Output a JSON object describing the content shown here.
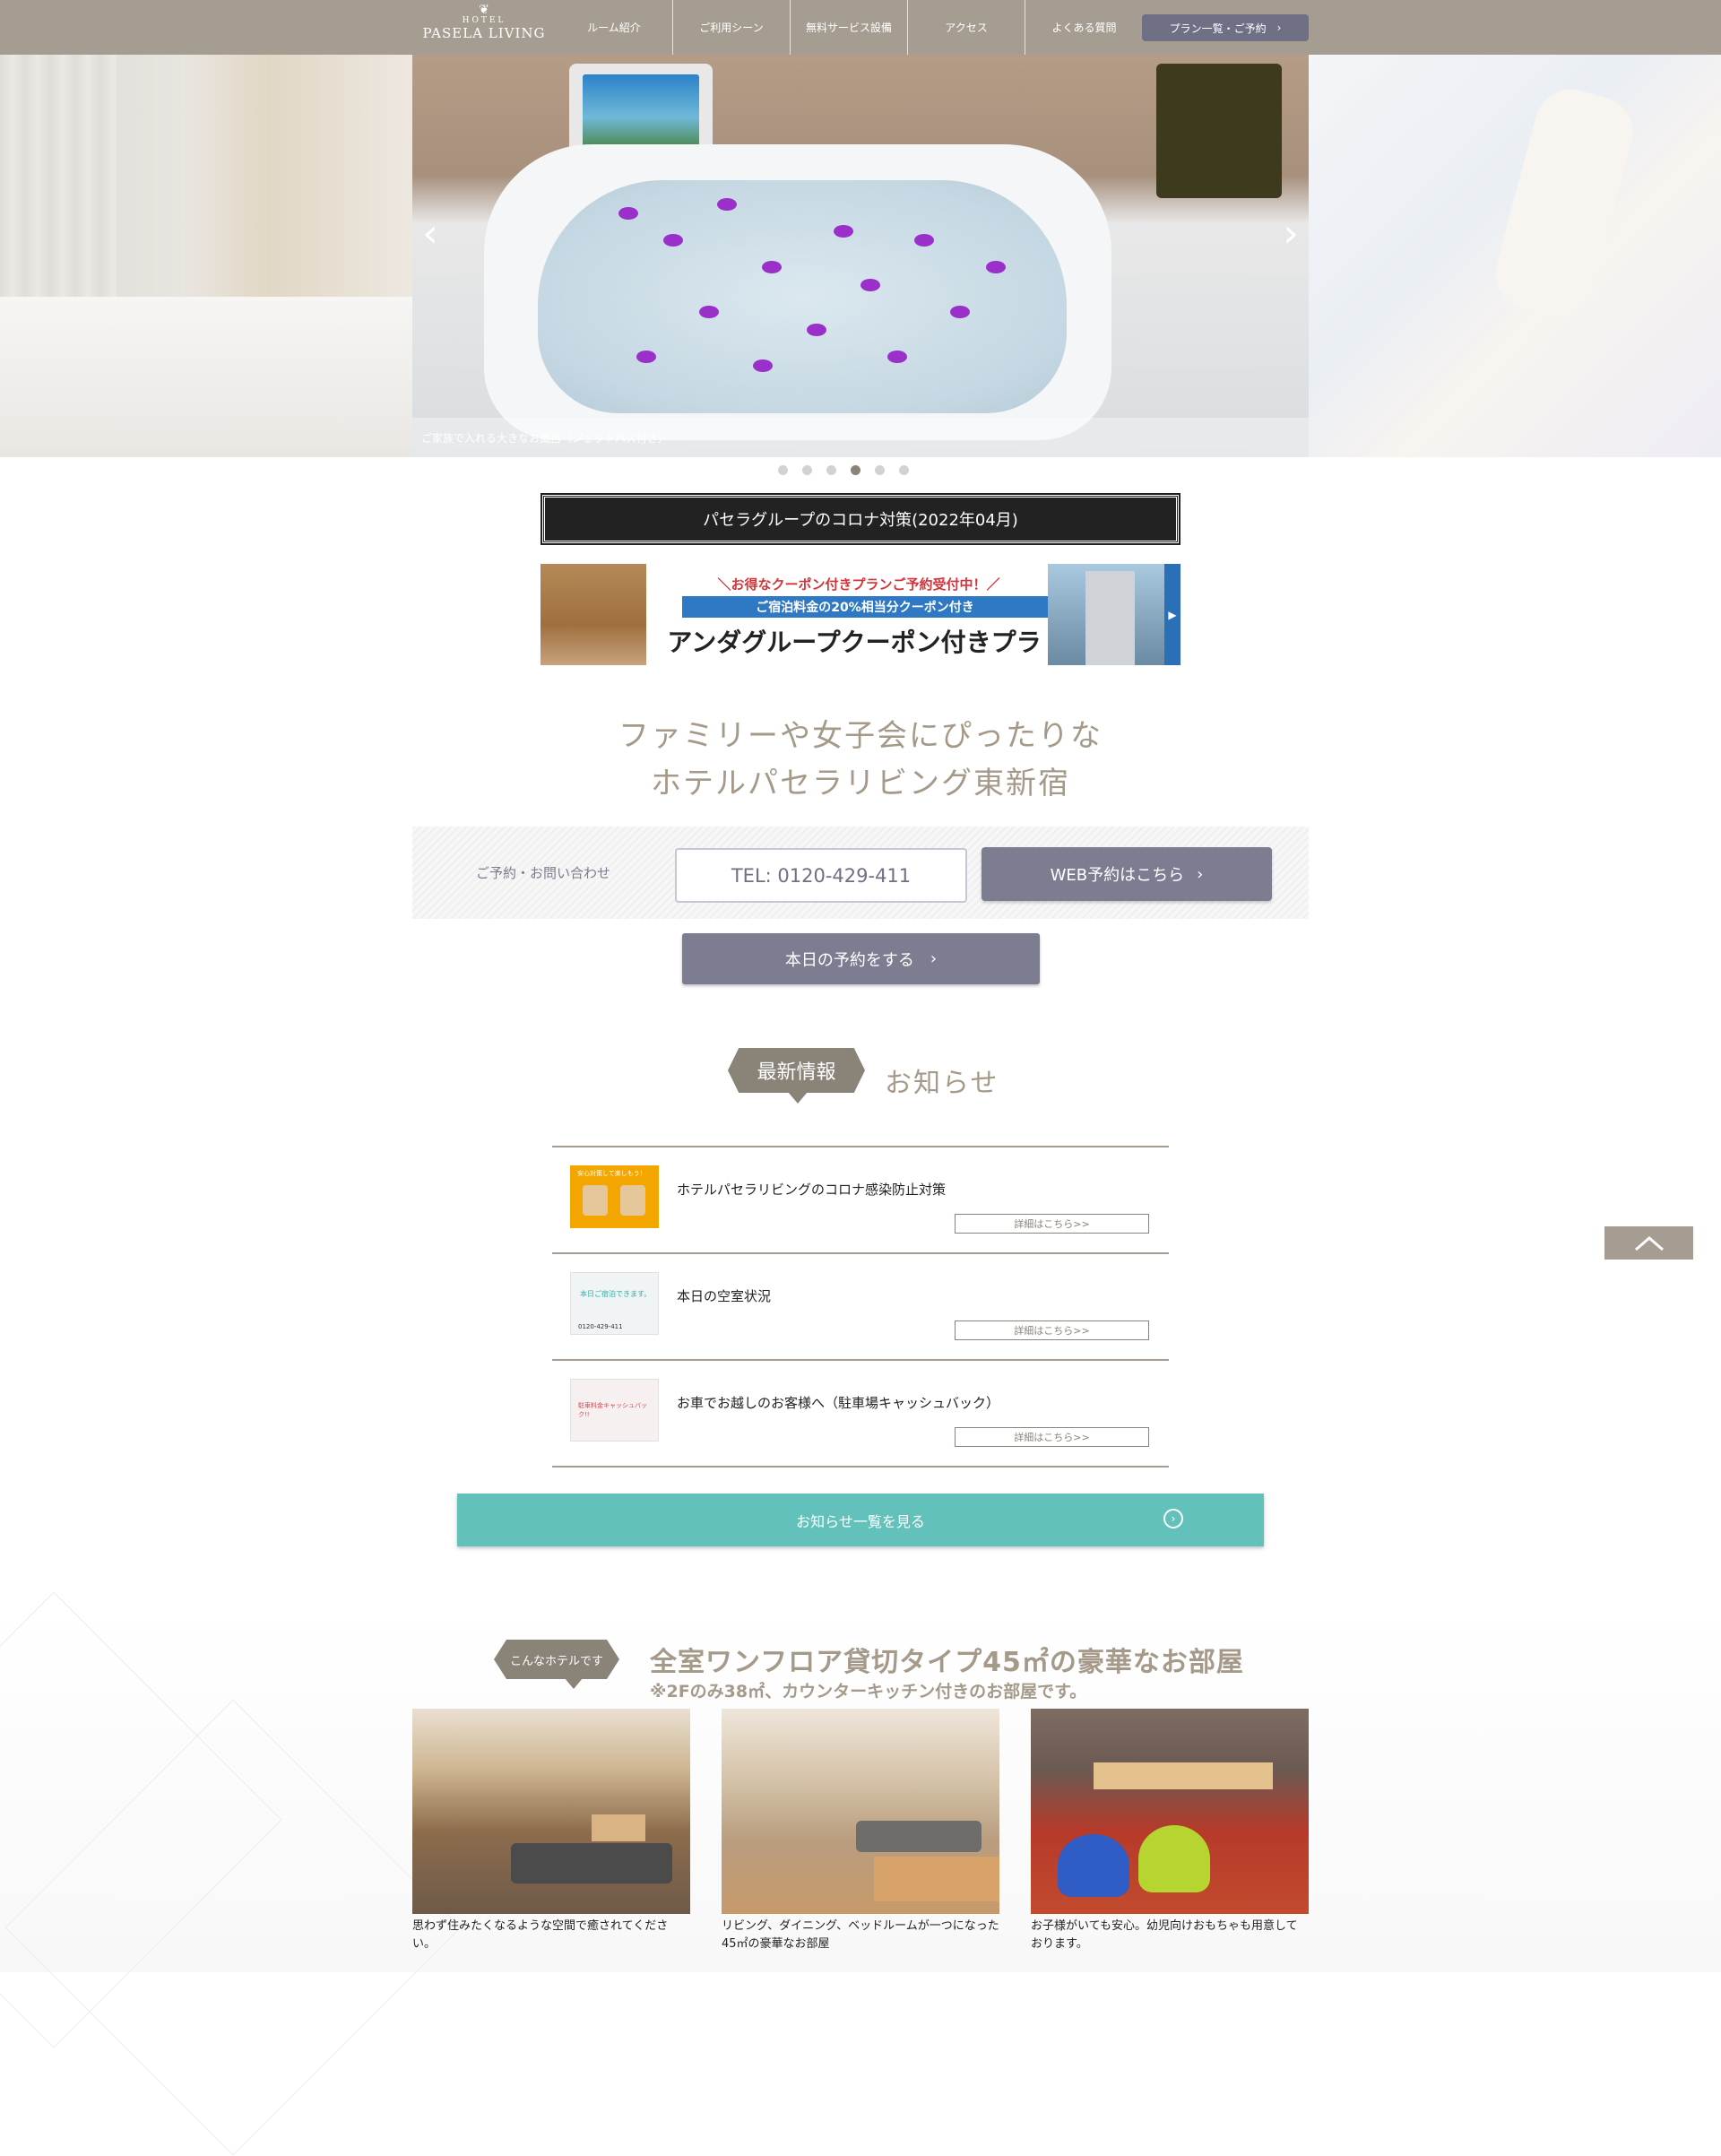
{
  "header": {
    "logo": {
      "hotel": "HOTEL",
      "name": "PASELA LIVING"
    },
    "nav": [
      "ルーム紹介",
      "ご利用シーン",
      "無料サービス設備",
      "アクセス",
      "よくある質問"
    ],
    "plan_button": "プラン一覧・ご予約"
  },
  "hero": {
    "caption": "ご家族で入れる大きなお風呂（ジェットバス付き）",
    "prev": "‹",
    "next": "›",
    "slide_count": 6,
    "active_slide": 4
  },
  "corona_button": "パセラグループのコロナ対策(2022年04月)",
  "banner": {
    "line1": "＼お得なクーポン付きプランご予約受付中！／",
    "line2": "ご宿泊料金の20%相当分クーポン付き",
    "line3": "アンダグループクーポン付きプラン"
  },
  "headline": {
    "line1": "ファミリーや女子会にぴったりな",
    "line2": "ホテルパセラリビング東新宿"
  },
  "contact": {
    "label": "ご予約・お問い合わせ",
    "tel": "TEL: 0120-429-411",
    "web": "WEB予約はこちら",
    "today": "本日の予約をする"
  },
  "news": {
    "tag": "最新情報",
    "title": "お知らせ",
    "more_label": "詳細はこちら>>",
    "items": [
      {
        "text": "ホテルパセラリビングのコロナ感染防止対策",
        "thumb_text": "安心対策して楽しもう！"
      },
      {
        "text": "本日の空室状況",
        "thumb_text": "本日ご宿泊できます。",
        "thumb_tel": "0120-429-411"
      },
      {
        "text": "お車でお越しのお客様へ（駐車場キャッシュバック）",
        "thumb_text": "駐車料金キャッシュバック!!"
      }
    ],
    "all_button": "お知らせ一覧を見る"
  },
  "about": {
    "tag": "こんなホテルです",
    "title": "全室ワンフロア貸切タイプ45㎡の豪華なお部屋",
    "subtitle": "※2Fのみ38㎡、カウンターキッチン付きのお部屋です。",
    "cards": [
      {
        "caption": "思わず住みたくなるような空間で癒されてください。"
      },
      {
        "caption": "リビング、ダイニング、ベッドルームが一つになった45㎡の豪華なお部屋"
      },
      {
        "caption": "お子様がいても安心。幼児向けおもちゃも用意しております。"
      }
    ]
  },
  "colors": {
    "header": "#a59d91",
    "accent": "#7d7d92",
    "teal": "#63c1bb",
    "text_beige": "#a59a8a"
  }
}
